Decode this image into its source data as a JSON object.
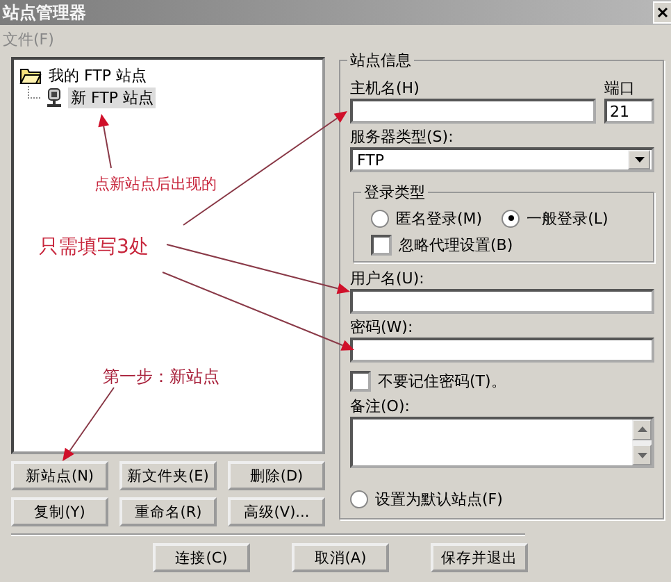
{
  "window": {
    "title": "站点管理器"
  },
  "menu": [
    {
      "label": "文件(F)",
      "disabled": true
    }
  ],
  "tree": {
    "items": [
      {
        "label": "我的 FTP 站点",
        "kind": "folder",
        "selected": false,
        "children": [
          {
            "label": "新 FTP 站点",
            "kind": "site",
            "selected": true
          }
        ]
      }
    ]
  },
  "tree_buttons": [
    "新站点(N)",
    "新文件夹(E)",
    "删除(D)",
    "复制(Y)",
    "重命名(R)",
    "高级(V)..."
  ],
  "site_info": {
    "title": "站点信息",
    "host": {
      "label": "主机名(H)"
    },
    "port": {
      "label": "端口",
      "value": "21"
    },
    "server_type": {
      "label": "服务器类型(S):",
      "value": "FTP"
    },
    "login_type": {
      "title": "登录类型",
      "options": [
        {
          "label": "匿名登录(M)",
          "selected": false
        },
        {
          "label": "一般登录(L)",
          "selected": true
        }
      ],
      "bypass_proxy": {
        "label": "忽略代理设置(B)",
        "checked": false
      }
    },
    "user": {
      "label": "用户名(U):"
    },
    "password": {
      "label": "密码(W):"
    },
    "dont_save_password": {
      "label": "不要记住密码(T)。",
      "checked": false
    },
    "notes": {
      "label": "备注(O):"
    },
    "default_site": {
      "label": "设置为默认站点(F)",
      "selected": false
    }
  },
  "footer_buttons": [
    "连接(C)",
    "取消(A)",
    "保存并退出"
  ],
  "annotations": [
    {
      "text": "点新站点后出现的"
    },
    {
      "text": "只需填写3处"
    },
    {
      "text": "第一步：新站点"
    }
  ]
}
